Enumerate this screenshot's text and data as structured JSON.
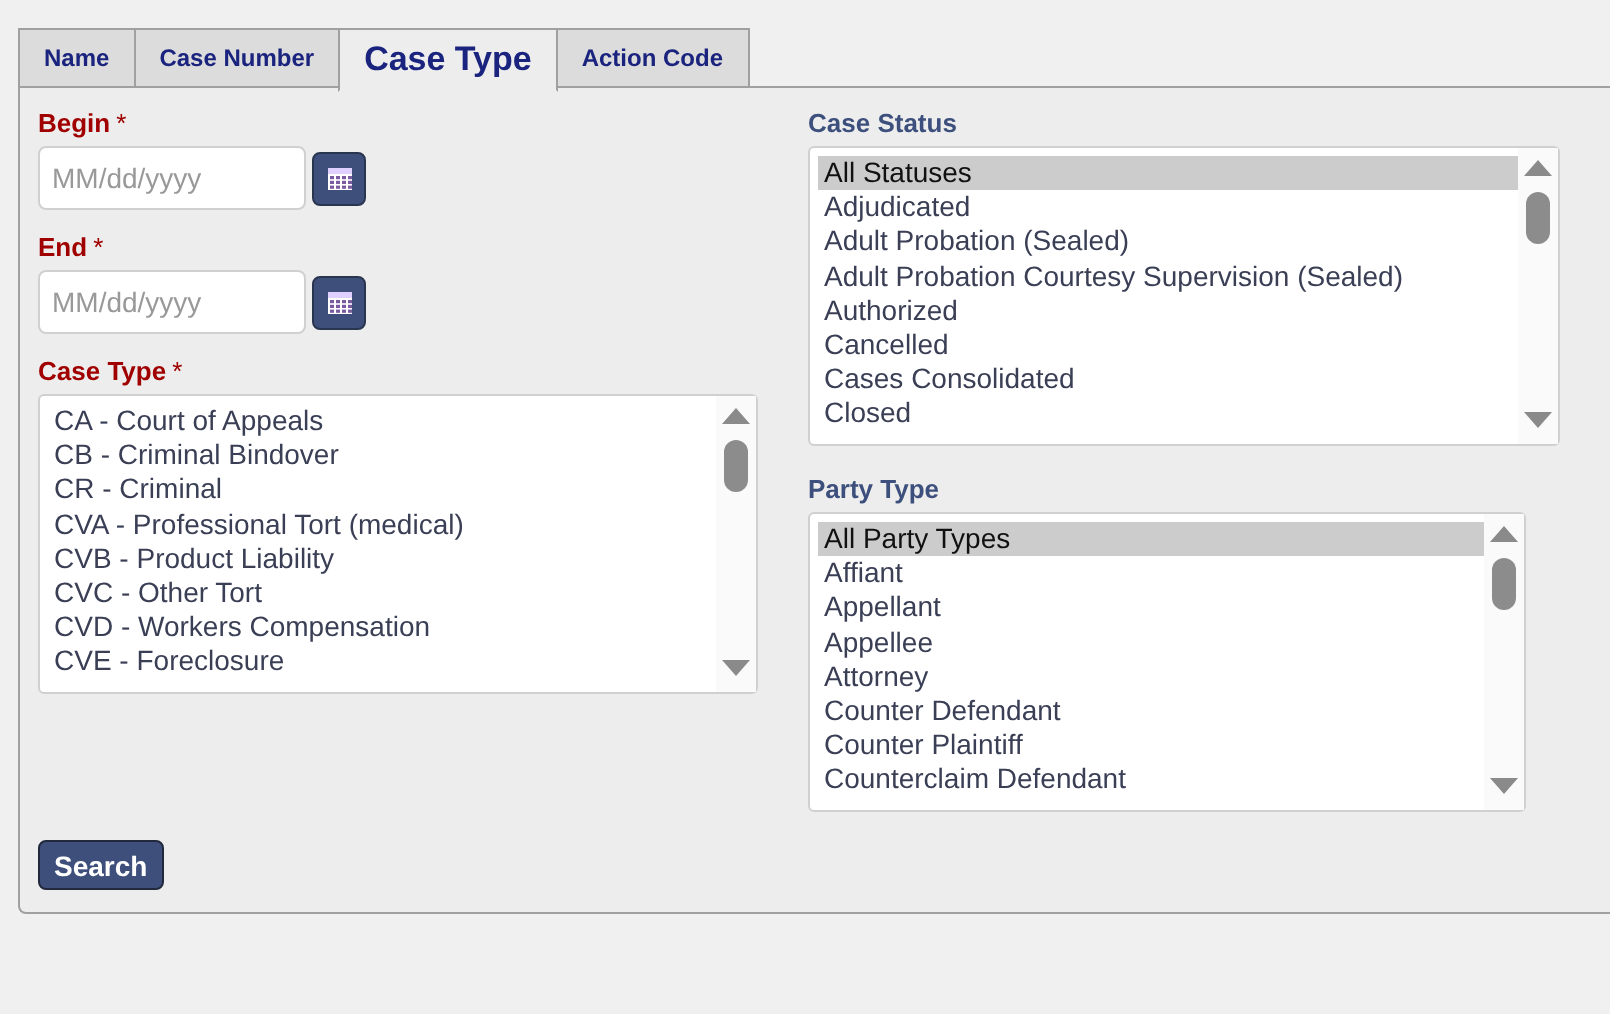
{
  "tabs": [
    {
      "label": "Name",
      "selected": false
    },
    {
      "label": "Case Number",
      "selected": false
    },
    {
      "label": "Case Type",
      "selected": true
    },
    {
      "label": "Action Code",
      "selected": false
    }
  ],
  "begin": {
    "label": "Begin",
    "required_mark": "*",
    "placeholder": "MM/dd/yyyy"
  },
  "end": {
    "label": "End",
    "required_mark": "*",
    "placeholder": "MM/dd/yyyy"
  },
  "case_type": {
    "label": "Case Type",
    "required_mark": "*",
    "options": [
      {
        "label": "CA - Court of Appeals",
        "selected": false
      },
      {
        "label": "CB - Criminal Bindover",
        "selected": false
      },
      {
        "label": "CR - Criminal",
        "selected": false
      },
      {
        "label": "CVA - Professional Tort (medical)",
        "selected": false
      },
      {
        "label": "CVB - Product Liability",
        "selected": false
      },
      {
        "label": "CVC - Other Tort",
        "selected": false
      },
      {
        "label": "CVD - Workers Compensation",
        "selected": false
      },
      {
        "label": "CVE - Foreclosure",
        "selected": false
      }
    ]
  },
  "case_status": {
    "label": "Case Status",
    "options": [
      {
        "label": "All Statuses",
        "selected": true
      },
      {
        "label": "Adjudicated",
        "selected": false
      },
      {
        "label": "Adult Probation (Sealed)",
        "selected": false
      },
      {
        "label": "Adult Probation Courtesy Supervision (Sealed)",
        "selected": false
      },
      {
        "label": "Authorized",
        "selected": false
      },
      {
        "label": "Cancelled",
        "selected": false
      },
      {
        "label": "Cases Consolidated",
        "selected": false
      },
      {
        "label": "Closed",
        "selected": false
      }
    ]
  },
  "party_type": {
    "label": "Party Type",
    "options": [
      {
        "label": "All Party Types",
        "selected": true
      },
      {
        "label": "Affiant",
        "selected": false
      },
      {
        "label": "Appellant",
        "selected": false
      },
      {
        "label": "Appellee",
        "selected": false
      },
      {
        "label": "Attorney",
        "selected": false
      },
      {
        "label": "Counter Defendant",
        "selected": false
      },
      {
        "label": "Counter Plaintiff",
        "selected": false
      },
      {
        "label": "Counterclaim Defendant",
        "selected": false
      }
    ]
  },
  "search_button": "Search"
}
